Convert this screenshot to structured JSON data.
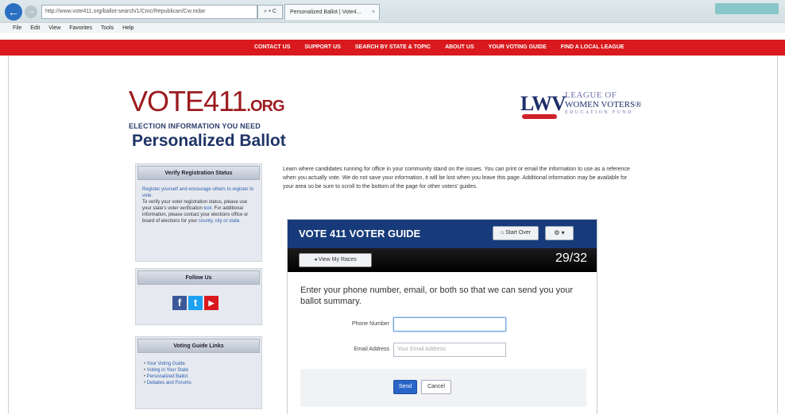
{
  "browser": {
    "address": "http://www.vote411.org/ballot-search/1/Cmc/Republican/Cw.mdar",
    "address_buttons": "⌕ ▾ C",
    "tab_title": "Personalized Ballot | Vote4...",
    "menu": [
      "File",
      "Edit",
      "View",
      "Favorites",
      "Tools",
      "Help"
    ]
  },
  "topnav": [
    "CONTACT US",
    "SUPPORT US",
    "SEARCH BY STATE & TOPIC",
    "ABOUT US",
    "YOUR VOTING GUIDE",
    "FIND A LOCAL LEAGUE"
  ],
  "logo": {
    "main": "VOTE411",
    "org": ".ORG",
    "tagline": "ELECTION INFORMATION YOU NEED"
  },
  "lwv": {
    "mark": "LWV",
    "line1": "LEAGUE OF",
    "line2": "WOMEN VOTERS®",
    "line3": "EDUCATION FUND"
  },
  "page_title": "Personalized Ballot",
  "sidebar": {
    "registration": {
      "title": "Verify Registration Status",
      "link1": "Register yourself and encourage others to register to vote.",
      "text1": "To verify your voter registration status, please use your state's voter verification",
      "link2": "tool.",
      "text2": "For additional information, please contact your elections office or board of elections for your",
      "link3": "county, city or state."
    },
    "follow": {
      "title": "Follow Us",
      "icons": [
        "facebook-icon",
        "twitter-icon",
        "youtube-icon"
      ]
    },
    "links": {
      "title": "Voting Guide Links",
      "items": [
        "Your Voting Guide",
        "Voting in Your State",
        "Personalized Ballot",
        "Debates and Forums"
      ]
    }
  },
  "intro": "Learn where candidates running for office in your community stand on the issues. You can print or email the information to use as a reference when you actually vote. We do not save your information, it will be lost when you leave this page. Additional information may be available for your area so be sure to scroll to the bottom of the page for other voters' guides.",
  "guide": {
    "title": "VOTE 411 VOTER GUIDE",
    "start_over": "Start Over",
    "gear": "⚙ ▾",
    "view_races": "View My Races",
    "progress": "29/32",
    "prompt": "Enter your phone number, email, or both so that we can send you your ballot summary.",
    "phone_label": "Phone Number",
    "phone_value": "",
    "email_label": "Email Address",
    "email_placeholder": "Your Email Address",
    "send": "Send",
    "cancel": "Cancel"
  },
  "colors": {
    "red_nav": "#d9191d",
    "guide_header": "#173b7a",
    "title_blue": "#1f3466"
  }
}
